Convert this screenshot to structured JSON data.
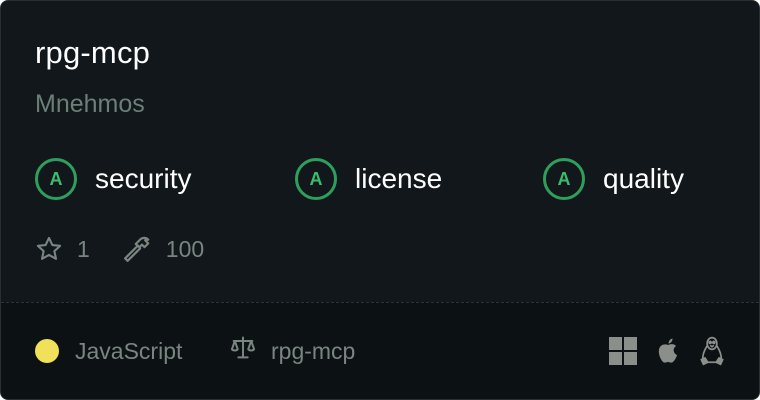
{
  "repo": {
    "name": "rpg-mcp",
    "owner": "Mnehmos"
  },
  "grades": [
    {
      "letter": "A",
      "label": "security"
    },
    {
      "letter": "A",
      "label": "license"
    },
    {
      "letter": "A",
      "label": "quality"
    }
  ],
  "stats": {
    "stars": "1",
    "tools": "100"
  },
  "footer": {
    "language": "JavaScript",
    "language_color": "#f1e05a",
    "license": "rpg-mcp",
    "platforms": [
      "windows-icon",
      "apple-icon",
      "linux-icon"
    ]
  },
  "colors": {
    "card_bg": "#11171a",
    "grade_accent": "#2f9e5d"
  }
}
